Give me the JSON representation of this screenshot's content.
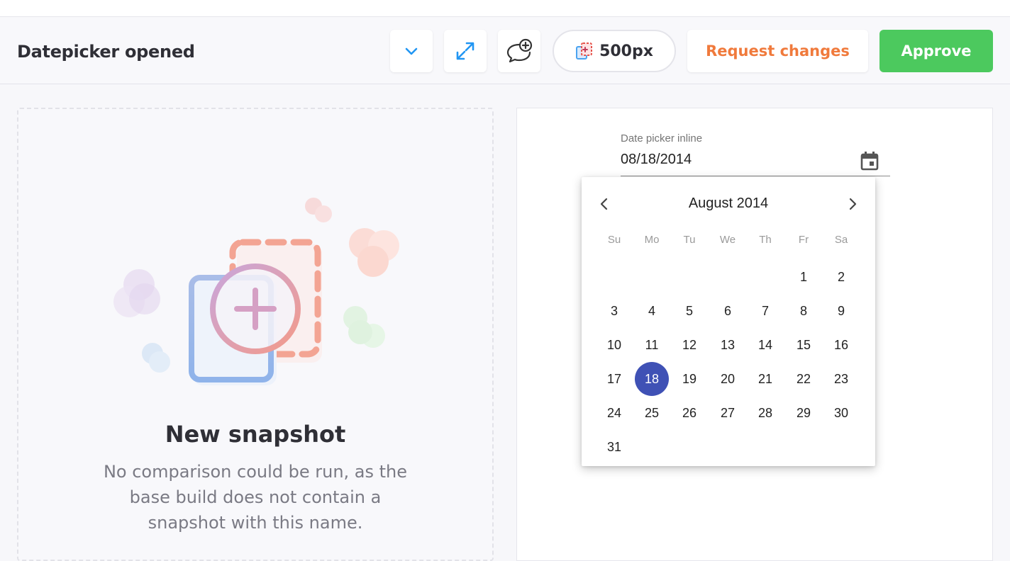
{
  "header": {
    "title": "Datepicker opened",
    "width_label": "500px",
    "request_changes_label": "Request changes",
    "approve_label": "Approve"
  },
  "left_panel": {
    "title": "New snapshot",
    "description": "No comparison could be run, as the base build does not contain a snapshot with this name."
  },
  "right_panel": {
    "field_label": "Date picker inline",
    "field_value": "08/18/2014",
    "calendar": {
      "month_label": "August 2014",
      "weekdays": [
        "Su",
        "Mo",
        "Tu",
        "We",
        "Th",
        "Fr",
        "Sa"
      ],
      "first_weekday_index": 5,
      "days_in_month": 31,
      "selected_day": 18
    }
  },
  "colors": {
    "accent_blue": "#2196f3",
    "request_orange": "#f07a3c",
    "approve_green": "#4cc95e",
    "selected_day": "#3f51b5"
  }
}
